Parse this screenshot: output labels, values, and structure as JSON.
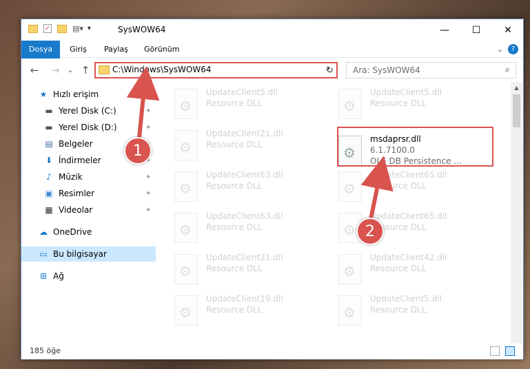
{
  "window": {
    "title": "SysWOW64",
    "controls": {
      "minimize": "—",
      "maximize": "☐",
      "close": "✕"
    }
  },
  "ribbon": {
    "tabs": [
      "Dosya",
      "Giriş",
      "Paylaş",
      "Görünüm"
    ],
    "expand": "⌄",
    "help": "?"
  },
  "nav": {
    "back": "←",
    "forward": "→",
    "recent": "⌄",
    "up": "↑",
    "address": "C:\\Windows\\SysWOW64",
    "address_dropdown": "⌄",
    "refresh": "↻",
    "search_placeholder": "Ara: SysWOW64",
    "search_icon": "⌕"
  },
  "sidebar": {
    "items": [
      {
        "label": "Hızlı erişim",
        "icon": "star-icon",
        "glyph": "★",
        "color": "#1979ca",
        "pinned": false
      },
      {
        "label": "Yerel Disk (C:)",
        "icon": "drive-icon",
        "glyph": "▬",
        "color": "#555555",
        "pinned": true
      },
      {
        "label": "Yerel Disk (D:)",
        "icon": "drive-icon",
        "glyph": "▬",
        "color": "#555555",
        "pinned": true
      },
      {
        "label": "Belgeler",
        "icon": "documents-icon",
        "glyph": "▤",
        "color": "#4a6fa5",
        "pinned": true
      },
      {
        "label": "İndirmeler",
        "icon": "download-icon",
        "glyph": "⬇",
        "color": "#1979ca",
        "pinned": true
      },
      {
        "label": "Müzik",
        "icon": "music-icon",
        "glyph": "♪",
        "color": "#1979ca",
        "pinned": true
      },
      {
        "label": "Resimler",
        "icon": "pictures-icon",
        "glyph": "▣",
        "color": "#3a8ad0",
        "pinned": true
      },
      {
        "label": "Videolar",
        "icon": "video-icon",
        "glyph": "▦",
        "color": "#333333",
        "pinned": true
      },
      {
        "label": "OneDrive",
        "icon": "cloud-icon",
        "glyph": "☁",
        "color": "#1979ca",
        "pinned": false
      },
      {
        "label": "Bu bilgisayar",
        "icon": "computer-icon",
        "glyph": "▭",
        "color": "#1979ca",
        "pinned": false,
        "selected": true
      },
      {
        "label": "Ağ",
        "icon": "network-icon",
        "glyph": "⊞",
        "color": "#1979ca",
        "pinned": false
      }
    ],
    "pin_glyph": "📌"
  },
  "files": {
    "left": [
      {
        "name": "UpdateClient5.dll",
        "desc": "Resource DLL"
      },
      {
        "name": "UpdateClient21.dll",
        "desc": "Resource DLL"
      },
      {
        "name": "UpdateClient63.dll",
        "desc": "Resource DLL"
      },
      {
        "name": "UpdateClient63.dll",
        "desc": "Resource DLL"
      },
      {
        "name": "UpdateClient21.dll",
        "desc": "Resource DLL"
      },
      {
        "name": "UpdateClient19.dll",
        "desc": "Resource DLL"
      }
    ],
    "right": [
      {
        "name": "UpdateClient5.dll",
        "desc": "Resource DLL"
      },
      {
        "name": "msdaprsr.dll",
        "desc": "6.1.7100.0",
        "desc2": "OLE DB Persistence ...",
        "highlight": true
      },
      {
        "name": "UpdateClient65.dll",
        "desc": "Resource DLL"
      },
      {
        "name": "UpdateClient65.dll",
        "desc": "Resource DLL"
      },
      {
        "name": "UpdateClient42.dll",
        "desc": "Resource DLL"
      },
      {
        "name": "UpdateClient5.dll",
        "desc": "Resource DLL"
      }
    ]
  },
  "status": {
    "count": "185 öğe"
  },
  "annotations": {
    "badge1": "1",
    "badge2": "2",
    "color": "#d9534f"
  }
}
